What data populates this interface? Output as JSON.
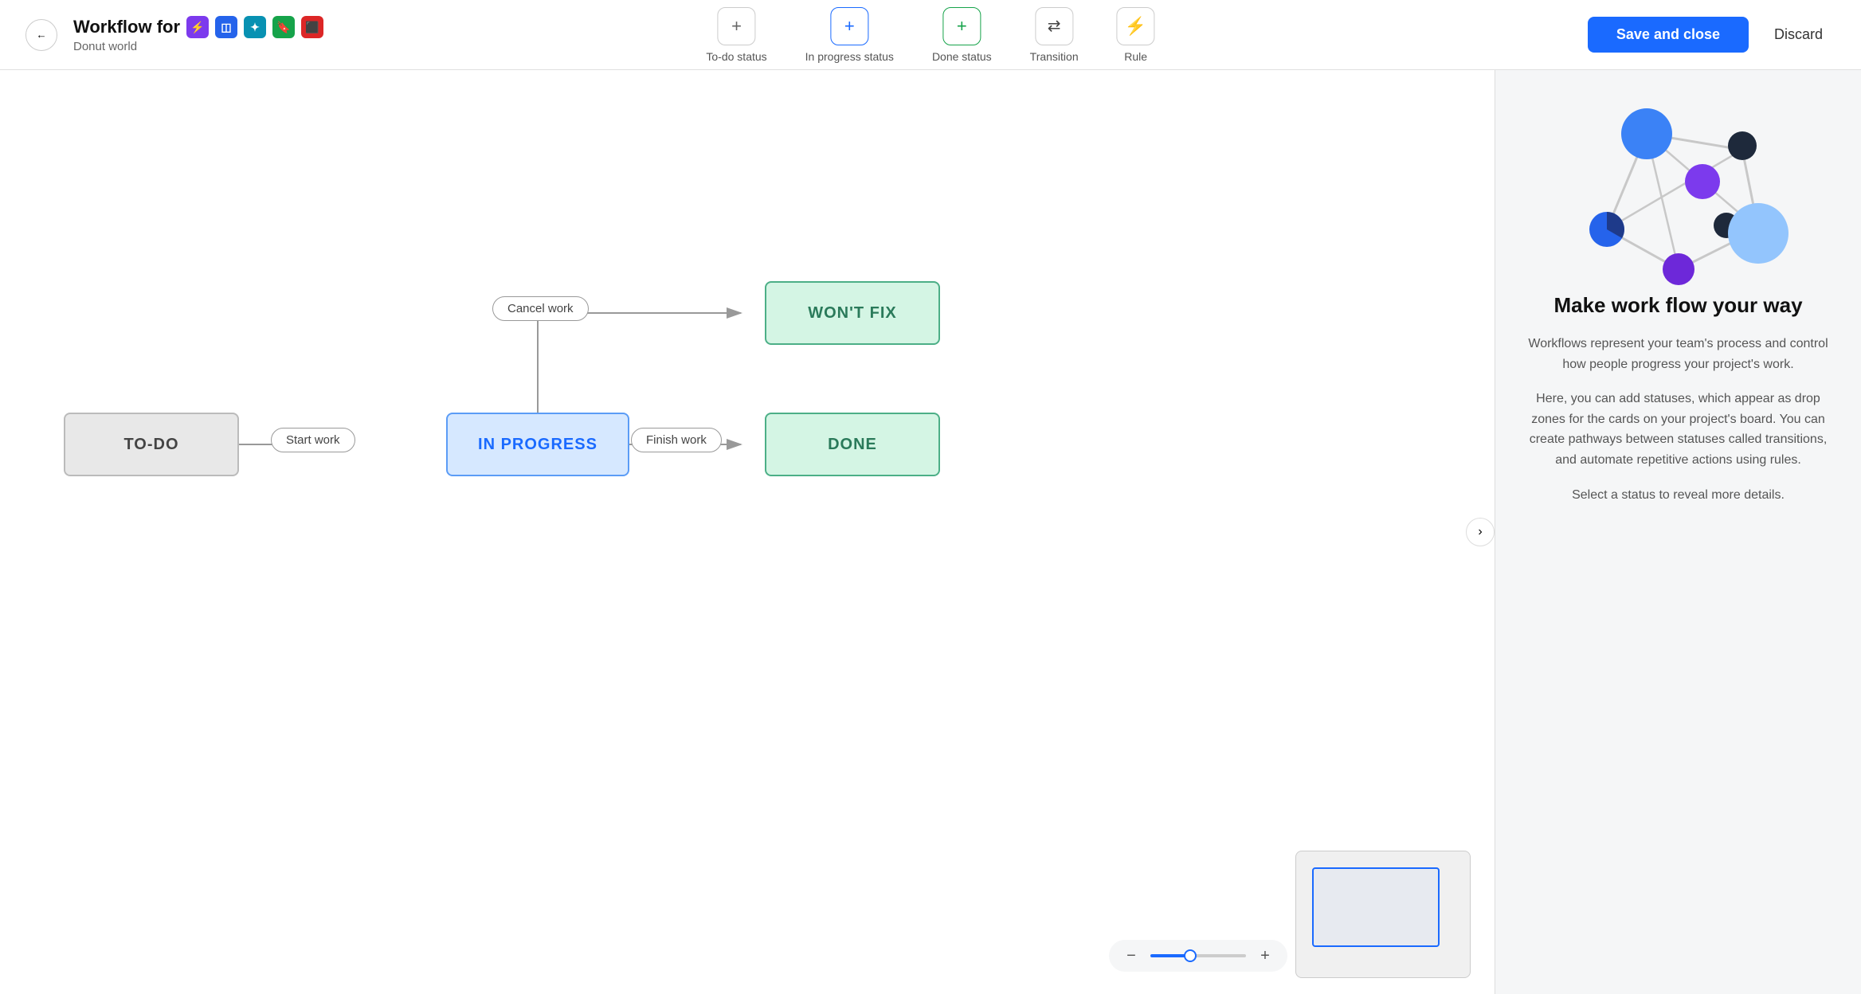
{
  "header": {
    "back_label": "←",
    "title": "Workflow for",
    "subtitle": "Donut world",
    "icons": [
      {
        "name": "bolt-icon",
        "color": "#7c3aed",
        "symbol": "⚡"
      },
      {
        "name": "grid-icon",
        "color": "#2563eb",
        "symbol": "⊞"
      },
      {
        "name": "puzzle-icon",
        "color": "#059669",
        "symbol": "✦"
      },
      {
        "name": "bookmark-icon",
        "color": "#16a34a",
        "symbol": "🔖"
      },
      {
        "name": "stop-icon",
        "color": "#dc2626",
        "symbol": "⬛"
      }
    ],
    "toolbar": {
      "items": [
        {
          "id": "todo-status",
          "label": "To-do status",
          "symbol": "+"
        },
        {
          "id": "inprogress-status",
          "label": "In progress status",
          "symbol": "+"
        },
        {
          "id": "done-status",
          "label": "Done status",
          "symbol": "+"
        },
        {
          "id": "transition",
          "label": "Transition",
          "symbol": "⬌"
        },
        {
          "id": "rule",
          "label": "Rule",
          "symbol": "⚡"
        }
      ]
    },
    "save_label": "Save and close",
    "discard_label": "Discard"
  },
  "diagram": {
    "nodes": [
      {
        "id": "todo",
        "label": "TO-DO"
      },
      {
        "id": "inprogress",
        "label": "IN PROGRESS"
      },
      {
        "id": "done",
        "label": "DONE"
      },
      {
        "id": "wontfix",
        "label": "WON'T FIX"
      }
    ],
    "transitions": [
      {
        "id": "start-work",
        "label": "Start work"
      },
      {
        "id": "cancel-work",
        "label": "Cancel work"
      },
      {
        "id": "finish-work",
        "label": "Finish work"
      }
    ]
  },
  "right_panel": {
    "title": "Make work flow your way",
    "description1": "Workflows represent your team's process and control how people progress your project's work.",
    "description2": "Here, you can add statuses, which appear as drop zones for the cards on your project's board. You can create pathways between statuses called transitions, and automate repetitive actions using rules.",
    "description3": "Select a status to reveal more details."
  },
  "zoom": {
    "value": 40
  }
}
